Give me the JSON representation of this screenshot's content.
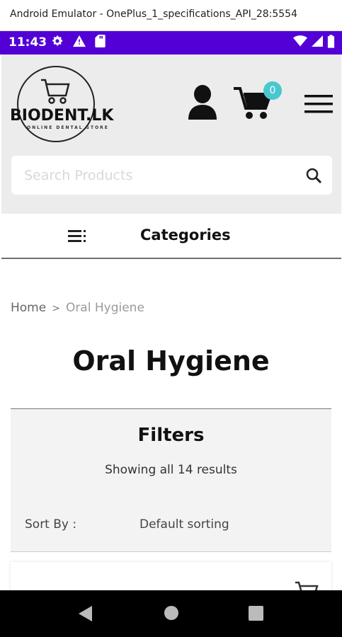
{
  "window": {
    "title": "Android Emulator - OnePlus_1_specifications_API_28:5554"
  },
  "status_bar": {
    "time": "11:43",
    "left_icons": [
      "gear-icon",
      "warning-icon",
      "sd-card-icon"
    ],
    "right_icons": [
      "wifi-icon",
      "cell-signal-icon",
      "battery-icon"
    ],
    "background": "#5200d6"
  },
  "header": {
    "logo_text": "BIODENT.LK",
    "logo_tagline": "ONLINE DENTAL STORE",
    "cart_count": "0",
    "badge_color": "#49c7cf"
  },
  "search": {
    "placeholder": "Search Products"
  },
  "categories": {
    "label": "Categories"
  },
  "breadcrumb": {
    "home": "Home",
    "separator": ">",
    "current": "Oral Hygiene"
  },
  "page": {
    "title": "Oral Hygiene"
  },
  "filters": {
    "title": "Filters",
    "results": "Showing all 14 results",
    "sort_label": "Sort By :",
    "sort_value": "Default sorting"
  }
}
